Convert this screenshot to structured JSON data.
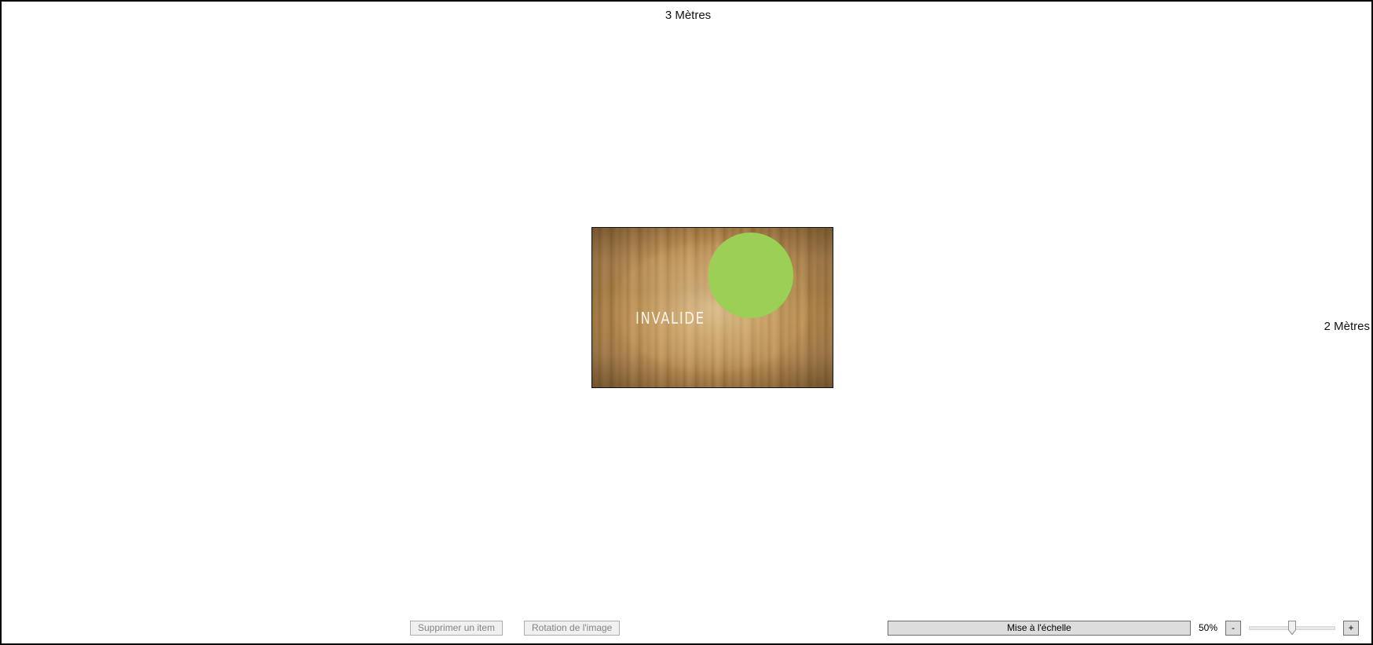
{
  "room": {
    "width_label": "3 Mètres",
    "height_label": "2 Mètres"
  },
  "table": {
    "stamp_text": "INVALIDE",
    "item_color": "#9ccf55"
  },
  "toolbar": {
    "delete_label": "Supprimer un item",
    "rotate_label": "Rotation de l'image",
    "scale_label": "Mise à l'échelle",
    "zoom_value": "50%",
    "zoom_fraction": 0.5,
    "minus_label": "-",
    "plus_label": "+"
  }
}
